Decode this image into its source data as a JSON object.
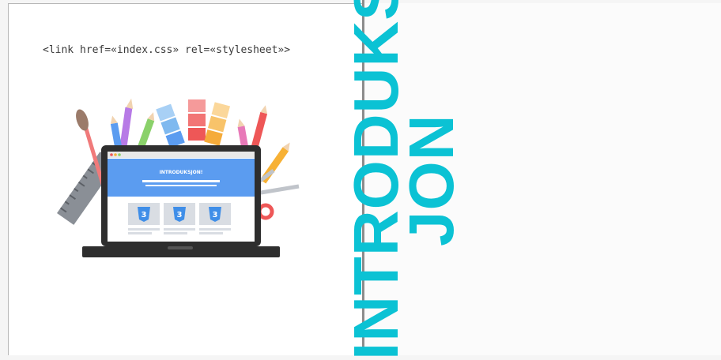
{
  "code": {
    "text": "<link href=«index.css» rel=«stylesheet»>"
  },
  "title": {
    "line1": "INTRODUKS",
    "line2": "JON"
  },
  "illustration": {
    "screen_title": "INTRODUKSJON!",
    "card_icon_label": "3",
    "colors": {
      "accent": "#0bc2d4",
      "screen_header": "#5b9cf0",
      "laptop": "#2e2e2e",
      "css_badge": "#3f8ee8"
    }
  }
}
